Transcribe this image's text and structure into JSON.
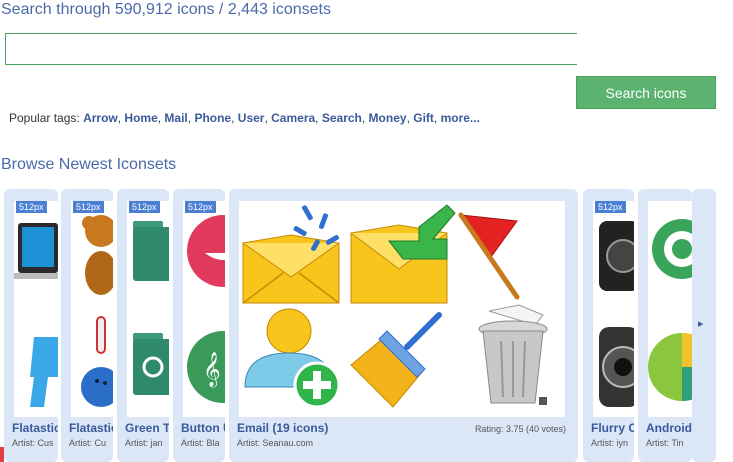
{
  "header": {
    "search_heading": "Search through 590,912 icons / 2,443 iconsets",
    "search_placeholder": "",
    "search_button": "Search icons"
  },
  "popular_tags": {
    "label": "Popular tags:",
    "tags": [
      "Arrow",
      "Home",
      "Mail",
      "Phone",
      "User",
      "Camera",
      "Search",
      "Money",
      "Gift"
    ],
    "more": "more..."
  },
  "browse": {
    "heading": "Browse Newest Iconsets",
    "cards": [
      {
        "badge": "512px",
        "title": "Flatastic",
        "artist": "Artist: Cus"
      },
      {
        "badge": "512px",
        "title": "Flatastic",
        "artist": "Artist: Cu"
      },
      {
        "badge": "512px",
        "title": "Green T",
        "artist": "Artist: jan"
      },
      {
        "badge": "512px",
        "title": "Button U",
        "artist": "Artist: Bla"
      },
      {
        "badge": "",
        "title": "Email (19 icons)",
        "artist": "Artist: Seanau.com",
        "rating": "Rating: 3.75 (40 votes)"
      },
      {
        "badge": "512px",
        "title": "Flurry C",
        "artist": "Artist: iyn"
      },
      {
        "badge": "",
        "title": "Android",
        "artist": "Artist: Tin"
      }
    ],
    "next_arrow": "▸"
  },
  "colors": {
    "heading": "#4b6aa8",
    "button_green": "#5cb370",
    "card_bg": "#dbe6f7",
    "badge_blue": "#4a7fd4",
    "link_blue": "#3a5a9a"
  }
}
